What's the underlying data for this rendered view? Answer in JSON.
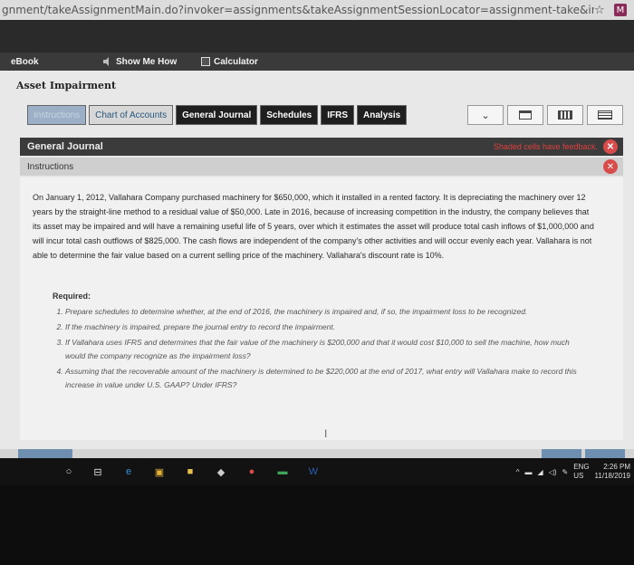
{
  "browser": {
    "url": "gnment/takeAssignmentMain.do?invoker=assignments&takeAssignmentSessionLocator=assignment-take&inprogress=false",
    "ext_label": "M"
  },
  "toolbar": {
    "ebook_label": "eBook",
    "show_me_label": "Show Me How",
    "calculator_label": "Calculator"
  },
  "page": {
    "title": "Asset Impairment"
  },
  "tabs": [
    {
      "label": "Instructions"
    },
    {
      "label": "Chart of Accounts"
    },
    {
      "label": "General Journal"
    },
    {
      "label": "Schedules"
    },
    {
      "label": "IFRS"
    },
    {
      "label": "Analysis"
    }
  ],
  "panel": {
    "header": "General Journal",
    "feedback_text": "Shaded cells have feedback.",
    "instructions_label": "Instructions"
  },
  "problem": {
    "paragraph": "On January 1, 2012, Vallahara Company purchased machinery for $650,000, which it installed in a rented factory. It is depreciating the machinery over 12 years by the straight-line method to a residual value of $50,000. Late in 2016, because of increasing competition in the industry, the company believes that its asset may be impaired and will have a remaining useful life of 5 years, over which it estimates the asset will produce total cash inflows of $1,000,000 and will incur total cash outflows of $825,000. The cash flows are independent of the company's other activities and will occur evenly each year. Vallahara is not able to determine the fair value based on a current selling price of the machinery. Vallahara's discount rate is 10%.",
    "required_label": "Required:",
    "required_items": [
      "Prepare schedules to determine whether, at the end of 2016, the machinery is impaired and, if so, the impairment loss to be recognized.",
      "If the machinery is impaired, prepare the journal entry to record the impairment.",
      "If Vallahara uses IFRS and determines that the fair value of the machinery is $200,000 and that it would cost $10,000 to sell the machine, how much would the company recognize as the impairment loss?",
      "Assuming that the recoverable amount of the machinery is determined to be $220,000 at the end of 2017, what entry will Vallahara make to record this increase in value under U.S. GAAP? Under IFRS?"
    ]
  },
  "taskbar": {
    "lang_top": "ENG",
    "lang_bottom": "US",
    "time": "2:26 PM",
    "date": "11/18/2019"
  }
}
